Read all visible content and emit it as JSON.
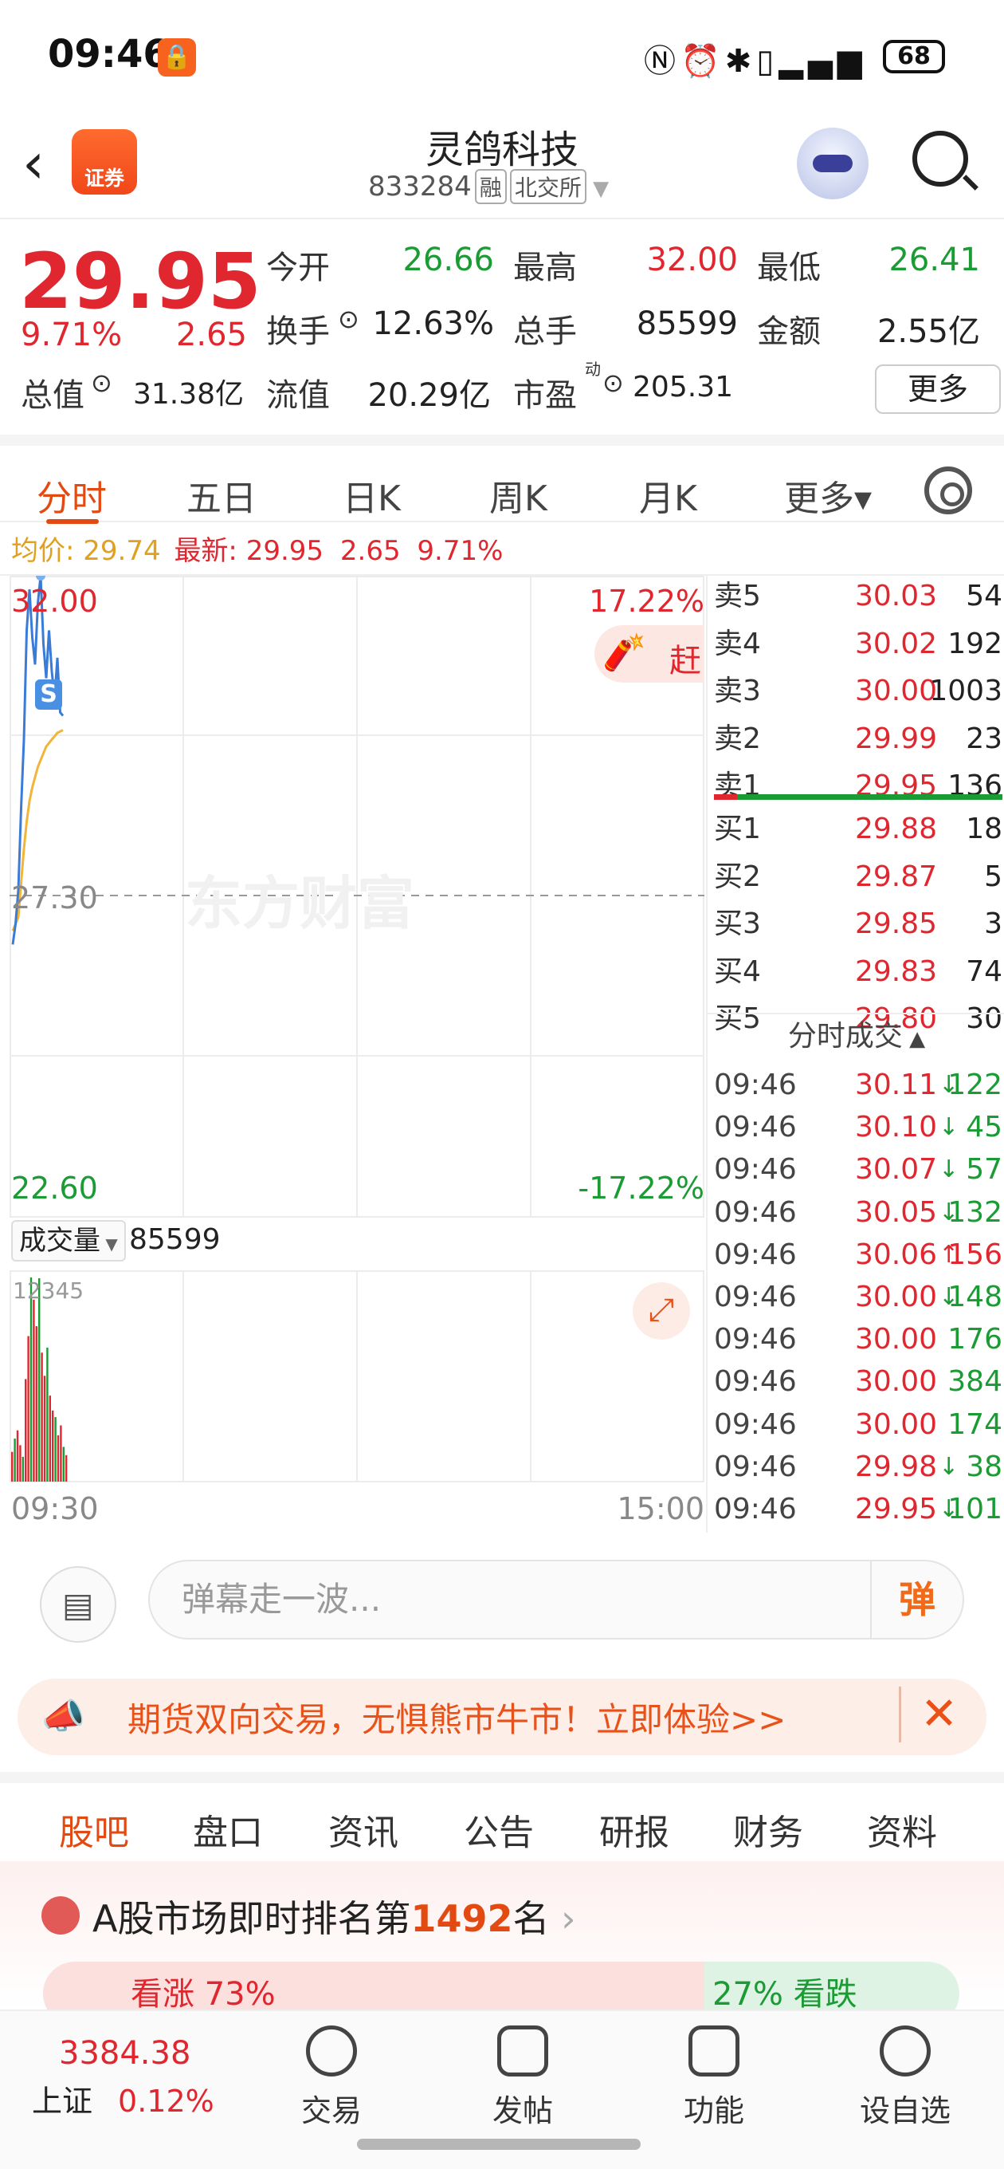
{
  "status_bar": {
    "time": "09:46",
    "battery": "68"
  },
  "header": {
    "title": "灵鸽科技",
    "code": "833284",
    "tag1": "融",
    "tag2": "北交所"
  },
  "quote": {
    "price": "29.95",
    "pct": "9.71%",
    "change": "2.65",
    "open_label": "今开",
    "open": "26.66",
    "high_label": "最高",
    "high": "32.00",
    "low_label": "最低",
    "low": "26.41",
    "turnover_label": "换手",
    "turnover": "12.63%",
    "volume_label": "总手",
    "volume": "85599",
    "amount_label": "金额",
    "amount": "2.55亿",
    "mktcap_label": "总值",
    "mktcap": "31.38亿",
    "float_label": "流值",
    "float": "20.29亿",
    "pe_label": "市盈",
    "pe_sup": "动",
    "pe": "205.31",
    "more": "更多"
  },
  "tabs": [
    "分时",
    "五日",
    "日K",
    "周K",
    "月K",
    "更多▾"
  ],
  "avg_line": {
    "avg_label": "均价:",
    "avg": "29.74",
    "latest_label": "最新:",
    "latest": "29.95",
    "change": "2.65",
    "pct": "9.71%"
  },
  "chart_labels": {
    "top_price": "32.00",
    "mid_price": "27.30",
    "bottom_price": "22.60",
    "top_pct": "17.22%",
    "bottom_pct": "-17.22%",
    "watermark": "东方财富",
    "badge": "赶快",
    "s_marker": "S",
    "start_time": "09:30",
    "end_time": "15:00"
  },
  "chart_data": {
    "type": "line",
    "price_range": [
      22.6,
      32.0
    ],
    "base_price": 27.3,
    "series": [
      {
        "values": [
          26.6,
          26.9,
          27.4,
          28.6,
          29.6,
          31.2,
          31.8,
          31.1,
          30.7,
          31.6,
          32.0,
          31.0,
          30.5,
          31.2,
          30.6,
          30.2,
          30.8,
          30.0,
          29.95
        ]
      },
      {
        "values": [
          26.8,
          26.9,
          27.0,
          27.5,
          28.0,
          28.4,
          28.7,
          28.9,
          29.05,
          29.2,
          29.3,
          29.4,
          29.5,
          29.55,
          29.6,
          29.65,
          29.7,
          29.72,
          29.74
        ]
      }
    ],
    "volume": {
      "max_label": "12345",
      "values": [
        1800,
        2600,
        3100,
        2200,
        1500,
        6200,
        8800,
        12345,
        11000,
        9400,
        12300,
        7800,
        6400,
        8100,
        5200,
        4300,
        3900,
        2800,
        3400,
        2100,
        1600
      ]
    }
  },
  "volume_header": {
    "label": "成交量",
    "value": "85599"
  },
  "orderbook": {
    "asks": [
      {
        "l": "卖5",
        "p": "30.03",
        "v": "54"
      },
      {
        "l": "卖4",
        "p": "30.02",
        "v": "192"
      },
      {
        "l": "卖3",
        "p": "30.00",
        "v": "1003"
      },
      {
        "l": "卖2",
        "p": "29.99",
        "v": "23"
      },
      {
        "l": "卖1",
        "p": "29.95",
        "v": "136"
      }
    ],
    "bids": [
      {
        "l": "买1",
        "p": "29.88",
        "v": "18"
      },
      {
        "l": "买2",
        "p": "29.87",
        "v": "5"
      },
      {
        "l": "买3",
        "p": "29.85",
        "v": "3"
      },
      {
        "l": "买4",
        "p": "29.83",
        "v": "74"
      },
      {
        "l": "买5",
        "p": "29.80",
        "v": "30"
      }
    ],
    "ticks_header": "分时成交",
    "ticks": [
      {
        "t": "09:46",
        "p": "30.11",
        "a": "down",
        "v": "122"
      },
      {
        "t": "09:46",
        "p": "30.10",
        "a": "down",
        "v": "45"
      },
      {
        "t": "09:46",
        "p": "30.07",
        "a": "down",
        "v": "57"
      },
      {
        "t": "09:46",
        "p": "30.05",
        "a": "down",
        "v": "132"
      },
      {
        "t": "09:46",
        "p": "30.06",
        "a": "up",
        "v": "156"
      },
      {
        "t": "09:46",
        "p": "30.00",
        "a": "down",
        "v": "148"
      },
      {
        "t": "09:46",
        "p": "30.00",
        "a": "",
        "v": "176"
      },
      {
        "t": "09:46",
        "p": "30.00",
        "a": "",
        "v": "384"
      },
      {
        "t": "09:46",
        "p": "30.00",
        "a": "",
        "v": "174"
      },
      {
        "t": "09:46",
        "p": "29.98",
        "a": "down",
        "v": "38"
      },
      {
        "t": "09:46",
        "p": "29.95",
        "a": "down",
        "v": "101"
      }
    ]
  },
  "danmu": {
    "placeholder": "弹幕走一波...",
    "send": "弹"
  },
  "banner": {
    "text": "期货双向交易，无惧熊市牛市！立即体验>>"
  },
  "bottom_tabs": [
    "股吧",
    "盘口",
    "资讯",
    "公告",
    "研报",
    "财务",
    "资料"
  ],
  "rank": {
    "prefix": "A股市场即时排名第",
    "rank": "1492",
    "suffix": "名",
    "up": "看涨 73%",
    "down": "27% 看跌"
  },
  "navbar": {
    "index_value": "3384.38",
    "index_name": "上证",
    "index_pct": "0.12%",
    "items": [
      "交易",
      "发帖",
      "功能",
      "设自选"
    ]
  },
  "colors": {
    "up": "#e0262e",
    "down": "#1a9b34",
    "accent": "#e34a12",
    "price_line": "#3b7bd8",
    "avg_line": "#f0b53a"
  }
}
